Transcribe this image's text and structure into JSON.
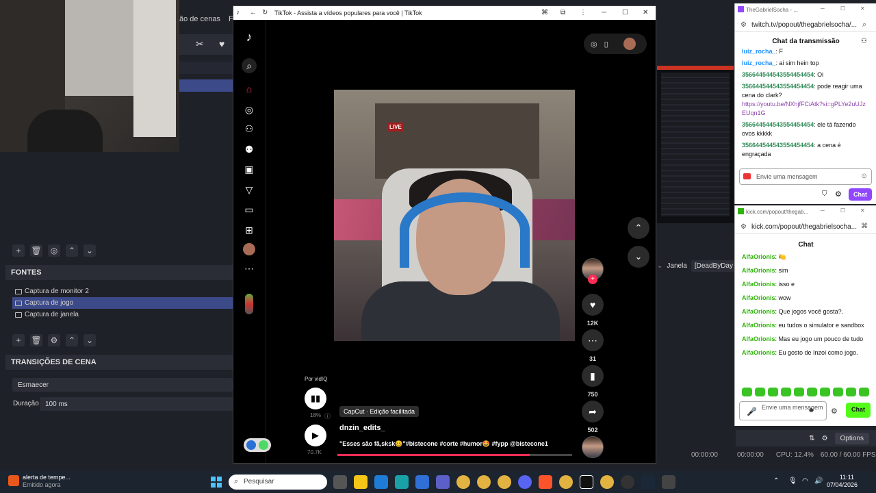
{
  "obs": {
    "menu": [
      "ão de cenas",
      "Ferra"
    ],
    "sources_header": "FONTES",
    "sources": [
      "Captura de monitor 2",
      "Captura de jogo",
      "Captura de janela"
    ],
    "transitions_header": "TRANSIÇÕES DE CENA",
    "transition_value": "Esmaecer",
    "duration_label": "Duração",
    "duration_value": "100 ms",
    "window_label": "Janela",
    "window_value": "[DeadByDay",
    "options_label": "Options",
    "status": {
      "time1": "00:00:00",
      "time2": "00:00:00",
      "cpu": "CPU: 12.4%",
      "fps": "60.00 / 60.00 FPS"
    }
  },
  "tiktok": {
    "window_title": "TikTok - Assista a vídeos populares para você | TikTok",
    "likes": "12K",
    "comments": "31",
    "saves": "750",
    "shares": "502",
    "author_label": "Por vidIQ",
    "vidiq_percent": "18%",
    "views": "70.7K",
    "capcut_label": "CapCut · Edição facilitada",
    "username": "dnzin_edits_",
    "caption": "\"Esses são fã,sksk🥴\"#bistecone #corte #humor🤩 #fypp @bistecone1",
    "live_sign": "LIVE",
    "progress_fraction": 0.82
  },
  "twitch": {
    "window_title": "TheGabrielSocha - ...",
    "url": "twitch.tv/popout/thegabrielsocha/...",
    "chat_title": "Chat da transmissão",
    "messages": [
      {
        "user": "luiz_rocha_",
        "text": ": F"
      },
      {
        "user": "luiz_rocha_",
        "text": ": ai sim hein top"
      },
      {
        "user": "356644544543554454454",
        "text": ": Oi"
      },
      {
        "user": "356644544543554454454",
        "text": ": pode reagir uma cena do clark?",
        "link": "https://youtu.be/NXhjfFCiAtk?si=gPLYe2uUJzEUqn1G"
      },
      {
        "user": "356644544543554454454",
        "text": ": ele tá fazendo ovos kkkkk"
      },
      {
        "user": "356644544543554454454",
        "text": ": a cena é engraçada"
      }
    ],
    "input_placeholder": "Envie uma mensagem",
    "chat_button": "Chat"
  },
  "kick": {
    "window_title": "kick.com/popout/thegab...",
    "url": "kick.com/popout/thegabrielsocha...",
    "chat_title": "Chat",
    "messages": [
      {
        "user": "AlfaOrionis",
        "text": ": 🍋"
      },
      {
        "user": "AlfaOrionis",
        "text": ": sim"
      },
      {
        "user": "AlfaOrionis",
        "text": ": isso e"
      },
      {
        "user": "AlfaOrionis",
        "text": ": wow"
      },
      {
        "user": "AlfaOrionis",
        "text": ": Que jogos você gosta?."
      },
      {
        "user": "AlfaOrionis",
        "text": ": eu tudos o simulator e sandbox"
      },
      {
        "user": "AlfaOrionis",
        "text": ": Mas eu jogo um pouco de tudo"
      },
      {
        "user": "AlfaOrionis",
        "text": ": Eu gosto de Inzoi como jogo."
      }
    ],
    "input_placeholder": "Envie uma mensagem",
    "chat_button": "Chat"
  },
  "taskbar": {
    "notification_title": "alerta de tempe...",
    "notification_sub": "Emitido agora",
    "search_placeholder": "Pesquisar",
    "time": "11:11",
    "date": "07/04/2026"
  }
}
